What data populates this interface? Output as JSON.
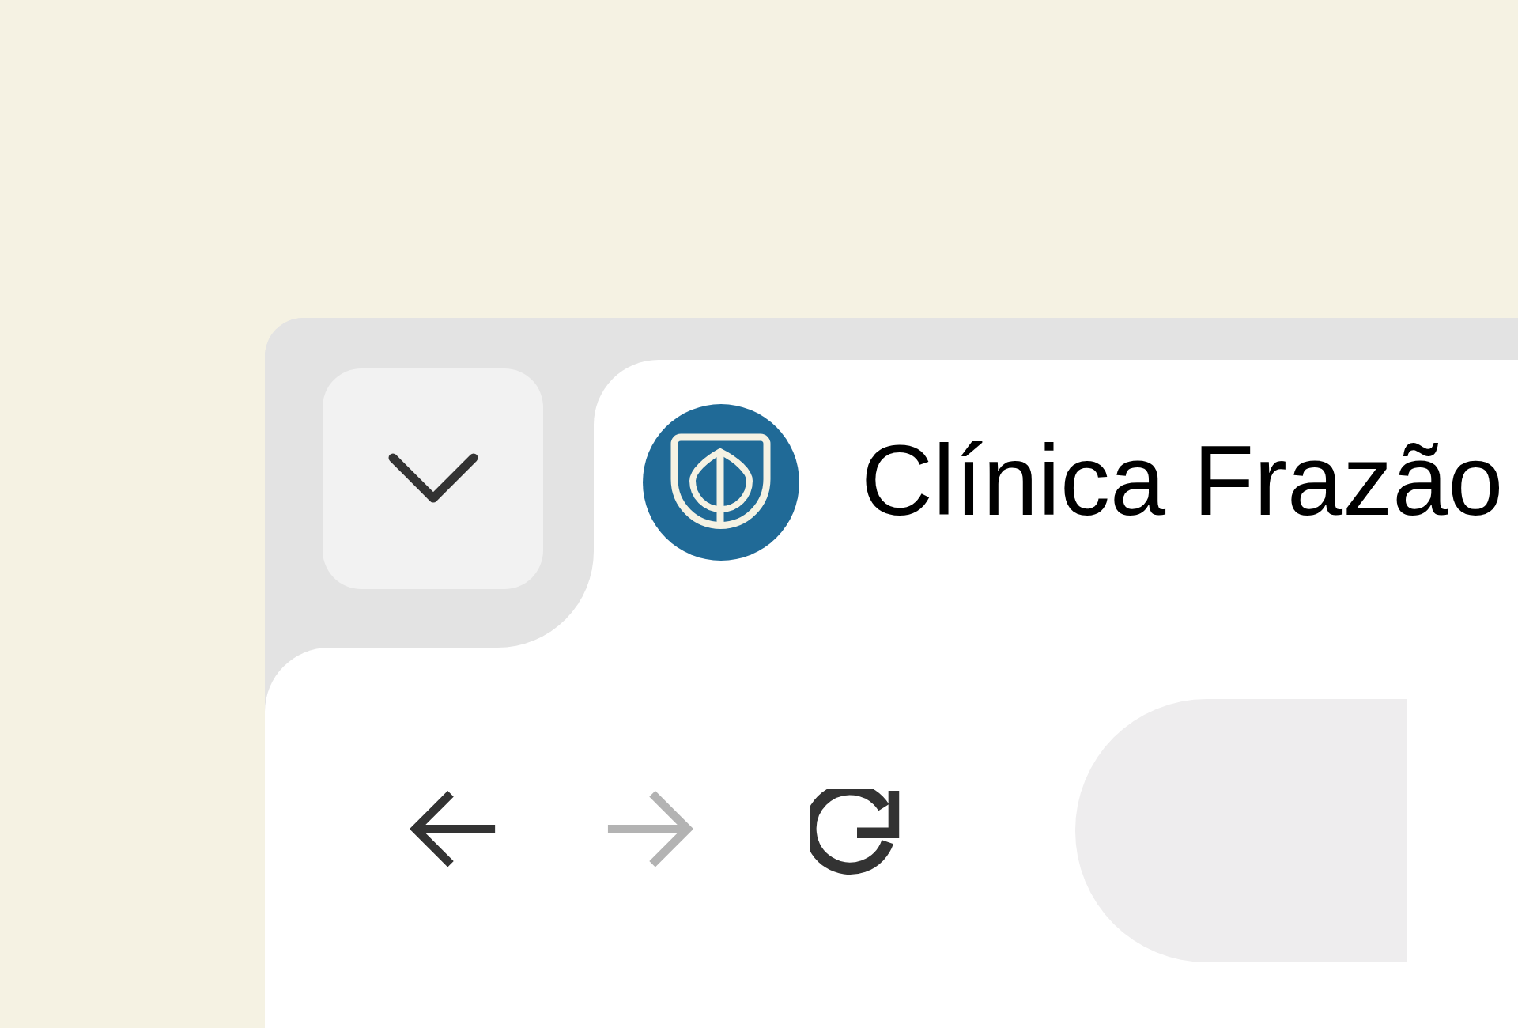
{
  "tab": {
    "title": "Clínica Frazão"
  },
  "nav_buttons": [
    {
      "kind": "back",
      "disabled": false
    },
    {
      "kind": "forward",
      "disabled": true
    },
    {
      "kind": "reload",
      "disabled": false
    }
  ]
}
